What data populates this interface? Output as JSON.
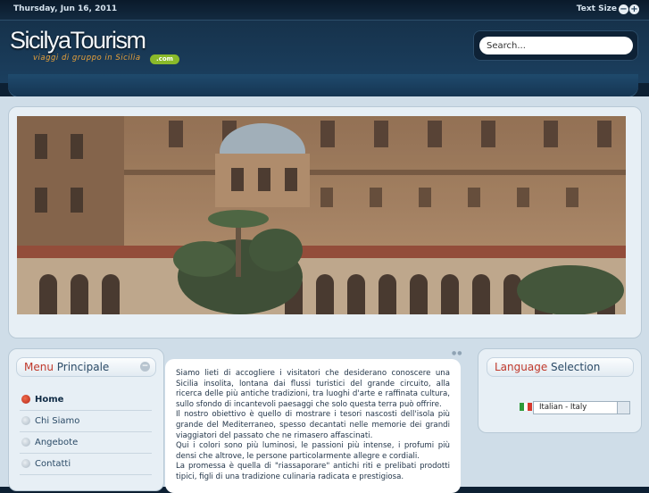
{
  "topbar": {
    "date": "Thursday, Jun 16, 2011",
    "text_size_label": "Text Size",
    "decrease": "−",
    "increase": "+"
  },
  "header": {
    "logo": "SicilyaTourism",
    "tagline": "viaggi di gruppo in Sicilia",
    "logo_suffix": ".com"
  },
  "search": {
    "placeholder": "Search..."
  },
  "menu": {
    "title_highlight": "Menu",
    "title_rest": " Principale",
    "collapse": "−",
    "items": [
      {
        "label": "Home",
        "active": true
      },
      {
        "label": "Chi Siamo",
        "active": false
      },
      {
        "label": "Angebote",
        "active": false
      },
      {
        "label": "Contatti",
        "active": false
      }
    ]
  },
  "main_text": {
    "p1": "Siamo lieti di accogliere i visitatori che desiderano conoscere una Sicilia insolita, lontana dai flussi turistici del grande circuito, alla ricerca delle più antiche tradizioni, tra luoghi d'arte e raffinata cultura, sullo sfondo di incantevoli paesaggi che solo questa terra può offrire.",
    "p2": "Il nostro obiettivo è quello di mostrare i tesori nascosti dell'isola più grande del Mediterraneo, spesso decantati nelle memorie dei grandi viaggiatori del passato che ne rimasero affascinati.",
    "p3": "Qui i colori sono più luminosi, le passioni più intense, i profumi più densi che altrove, le persone particolarmente allegre e cordiali.",
    "p4": "La promessa è quella di \"riassaporare\" antichi riti e prelibati prodotti tipici, figli di una tradizione culinaria radicata e prestigiosa."
  },
  "language": {
    "title_highlight": "Language",
    "title_rest": " Selection",
    "selected": "Italian - Italy",
    "flag_colors": [
      "#2e9b3a",
      "#ffffff",
      "#d63a2f"
    ]
  },
  "colors": {
    "accent": "#c0392b",
    "header": "#16324b",
    "content_bg": "#cfdde8"
  }
}
